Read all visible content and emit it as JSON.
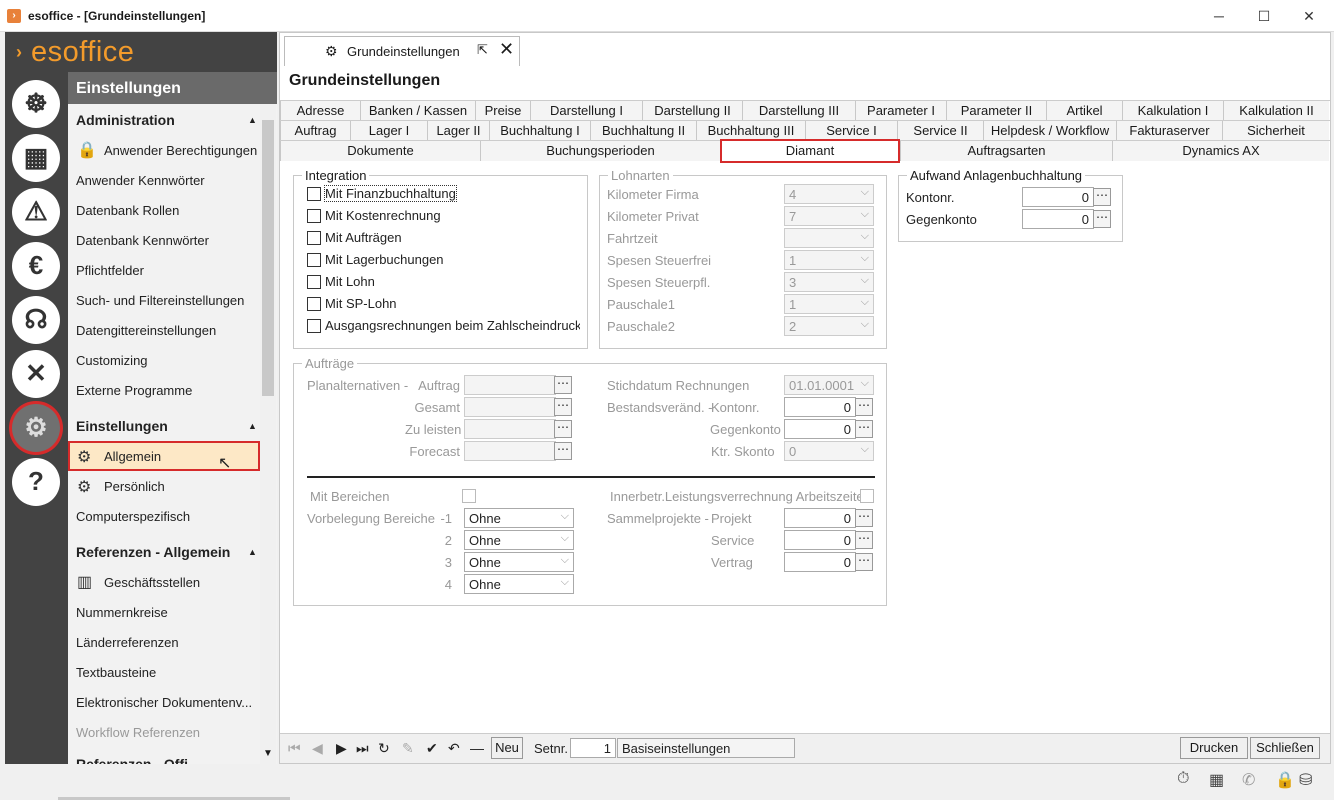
{
  "window": {
    "title": "esoffice - [Grundeinstellungen]",
    "min": "─",
    "max": "☐",
    "close": "✕"
  },
  "logo": "esoffice",
  "nav": {
    "header": "Einstellungen",
    "sections": {
      "admin": "Administration",
      "einst": "Einstellungen",
      "ref": "Referenzen - Allgemein",
      "refoff": "Referenzen - Offi..."
    },
    "items": {
      "anwender_berechtigungen": "Anwender Berechtigungen",
      "anwender_kennwoerter": "Anwender Kennwörter",
      "datenbank_rollen": "Datenbank Rollen",
      "datenbank_kennwoerter": "Datenbank Kennwörter",
      "pflichtfelder": "Pflichtfelder",
      "such_filter": "Such- und Filtereinstellungen",
      "datengitter": "Datengittereinstellungen",
      "customizing": "Customizing",
      "externe_programme": "Externe Programme",
      "allgemein": "Allgemein",
      "persoenlich": "Persönlich",
      "computerspezifisch": "Computerspezifisch",
      "geschaeftsstellen": "Geschäftsstellen",
      "nummernkreise": "Nummernkreise",
      "laenderreferenzen": "Länderreferenzen",
      "textbausteine": "Textbausteine",
      "elektronisch": "Elektronischer Dokumentenv...",
      "workflow": "Workflow Referenzen"
    }
  },
  "doctab": {
    "label": "Grundeinstellungen"
  },
  "page_title": "Grundeinstellungen",
  "tabs_row1": [
    "Adresse",
    "Banken / Kassen",
    "Preise",
    "Darstellung I",
    "Darstellung II",
    "Darstellung III",
    "Parameter I",
    "Parameter II",
    "Artikel",
    "Kalkulation I",
    "Kalkulation II"
  ],
  "tabs_row2": [
    "Auftrag",
    "Lager I",
    "Lager II",
    "Buchhaltung I",
    "Buchhaltung II",
    "Buchhaltung III",
    "Service I",
    "Service II",
    "Helpdesk / Workflow",
    "Fakturaserver",
    "Sicherheit"
  ],
  "tabs_row3": [
    "Dokumente",
    "Buchungsperioden",
    "Diamant",
    "Auftragsarten",
    "Dynamics AX"
  ],
  "integration": {
    "legend": "Integration",
    "checks": [
      "Mit Finanzbuchhaltung",
      "Mit Kostenrechnung",
      "Mit Aufträgen",
      "Mit Lagerbuchungen",
      "Mit Lohn",
      "Mit SP-Lohn",
      "Ausgangsrechnungen beim Zahlscheindruck"
    ]
  },
  "lohnarten": {
    "legend": "Lohnarten",
    "rows": [
      {
        "label": "Kilometer Firma",
        "value": "4"
      },
      {
        "label": "Kilometer Privat",
        "value": "7"
      },
      {
        "label": "Fahrtzeit",
        "value": ""
      },
      {
        "label": "Spesen Steuerfrei",
        "value": "1"
      },
      {
        "label": "Spesen Steuerpfl.",
        "value": "3"
      },
      {
        "label": "Pauschale1",
        "value": "1"
      },
      {
        "label": "Pauschale2",
        "value": "2"
      }
    ]
  },
  "aufwand": {
    "legend": "Aufwand Anlagenbuchhaltung",
    "kontonr_label": "Kontonr.",
    "kontonr": "0",
    "gegenkonto_label": "Gegenkonto",
    "gegenkonto": "0"
  },
  "auftraege": {
    "legend": "Aufträge",
    "plan_label": "Planalternativen -",
    "plan_rows": [
      "Auftrag",
      "Gesamt",
      "Zu leisten",
      "Forecast"
    ],
    "stichdatum_label": "Stichdatum Rechnungen",
    "stichdatum": "01.01.0001",
    "bestand_label": "Bestandsveränd. -",
    "bestand_kontonr_label": "Kontonr.",
    "bestand_kontonr": "0",
    "bestand_gegen_label": "Gegenkonto",
    "bestand_gegen": "0",
    "skonto_label": "Ktr. Skonto",
    "skonto": "0",
    "bereiche_label": "Mit Bereichen",
    "innerbetr_label": "Innerbetr.Leistungsverrechnung Arbeitszeiten",
    "vorbel_label": "Vorbelegung Bereiche",
    "vorbel": [
      {
        "n": "-1",
        "v": "Ohne"
      },
      {
        "n": "2",
        "v": "Ohne"
      },
      {
        "n": "3",
        "v": "Ohne"
      },
      {
        "n": "4",
        "v": "Ohne"
      }
    ],
    "sammel_label": "Sammelprojekte -",
    "projekt_label": "Projekt",
    "projekt": "0",
    "service_label": "Service",
    "service": "0",
    "vertrag_label": "Vertrag",
    "vertrag": "0"
  },
  "bottom": {
    "neu": "Neu",
    "setnr_label": "Setnr.",
    "setnr": "1",
    "setname": "Basiseinstellungen",
    "drucken": "Drucken",
    "schliessen": "Schließen"
  },
  "colors": {
    "accent": "#f39b2b",
    "highlight": "#d62b2b",
    "selected_bg": "#fde8c6"
  }
}
